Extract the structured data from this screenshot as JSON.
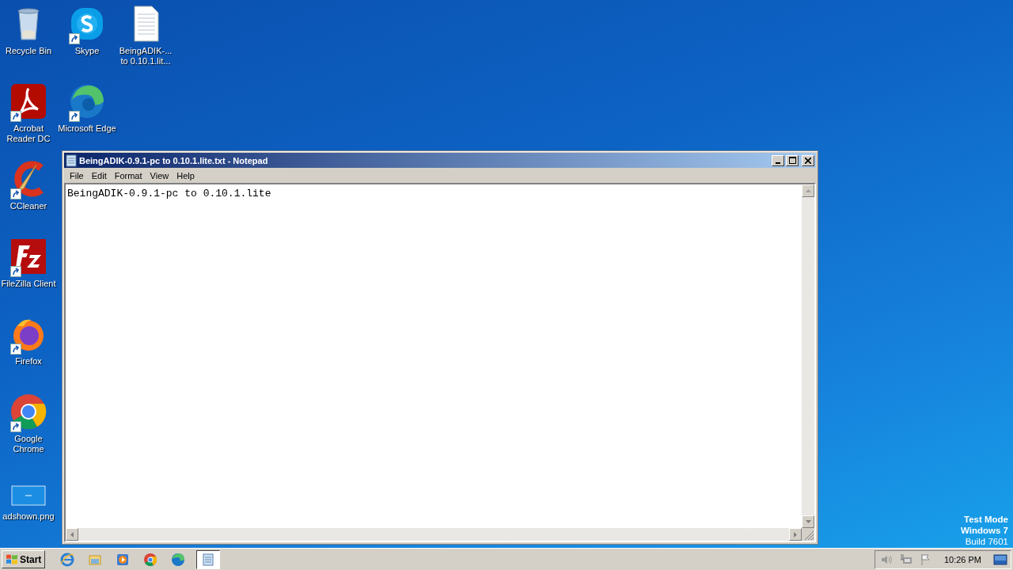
{
  "desktop": {
    "icons": [
      {
        "label": "Recycle Bin",
        "kind": "trash",
        "shortcut": false
      },
      {
        "label": "Skype",
        "kind": "skype",
        "shortcut": true
      },
      {
        "label": "BeingADIK-...\nto 0.10.1.lit...",
        "kind": "textfile",
        "shortcut": false
      },
      {
        "label": "Acrobat\nReader DC",
        "kind": "acrobat",
        "shortcut": true
      },
      {
        "label": "Microsoft Edge",
        "kind": "edge",
        "shortcut": true
      },
      {
        "label": "CCleaner",
        "kind": "ccleaner",
        "shortcut": true
      },
      {
        "label": "FileZilla Client",
        "kind": "filezilla",
        "shortcut": true
      },
      {
        "label": "Firefox",
        "kind": "firefox",
        "shortcut": true
      },
      {
        "label": "Google\nChrome",
        "kind": "chrome",
        "shortcut": true
      },
      {
        "label": "adshown.png",
        "kind": "image",
        "shortcut": false
      }
    ]
  },
  "system_notice": [
    "Test Mode",
    "Windows 7",
    "Build 7601"
  ],
  "notepad": {
    "title": "BeingADIK-0.9.1-pc to 0.10.1.lite.txt - Notepad",
    "menu": [
      "File",
      "Edit",
      "Format",
      "View",
      "Help"
    ],
    "content": "BeingADIK-0.9.1-pc to 0.10.1.lite"
  },
  "taskbar": {
    "start": "Start",
    "apps": [
      {
        "kind": "ie",
        "selected": false
      },
      {
        "kind": "explorer",
        "selected": false
      },
      {
        "kind": "player",
        "selected": false
      },
      {
        "kind": "chrome",
        "selected": false
      },
      {
        "kind": "edge",
        "selected": false
      },
      {
        "kind": "notepad",
        "selected": true
      }
    ],
    "clock": "10:26 PM"
  }
}
